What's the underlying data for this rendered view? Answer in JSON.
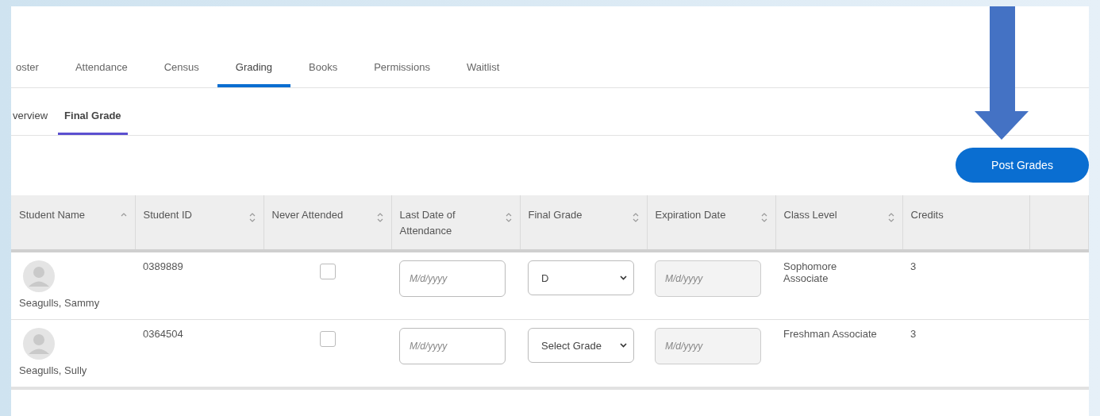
{
  "tabs": [
    {
      "label": "oster",
      "selected": false
    },
    {
      "label": "Attendance",
      "selected": false
    },
    {
      "label": "Census",
      "selected": false
    },
    {
      "label": "Grading",
      "selected": true
    },
    {
      "label": "Books",
      "selected": false
    },
    {
      "label": "Permissions",
      "selected": false
    },
    {
      "label": "Waitlist",
      "selected": false
    }
  ],
  "subtabs": [
    {
      "label": "verview",
      "selected": false
    },
    {
      "label": "Final Grade",
      "selected": true
    }
  ],
  "post_button": {
    "label": "Post Grades"
  },
  "table": {
    "columns": [
      {
        "label": "Student Name",
        "sort_up": true,
        "sort_down": false
      },
      {
        "label": "Student ID",
        "sort_up": true,
        "sort_down": true
      },
      {
        "label": "Never Attended",
        "sort_up": true,
        "sort_down": true
      },
      {
        "label": "Last Date of Attendance",
        "sort_up": true,
        "sort_down": true
      },
      {
        "label": "Final Grade",
        "sort_up": true,
        "sort_down": true
      },
      {
        "label": "Expiration Date",
        "sort_up": true,
        "sort_down": true
      },
      {
        "label": "Class Level",
        "sort_up": true,
        "sort_down": true
      },
      {
        "label": "Credits",
        "sort_up": false,
        "sort_down": false
      }
    ],
    "rows": [
      {
        "name": "Seagulls, Sammy",
        "student_id": "0389889",
        "never_attended": {
          "checked": false
        },
        "last_date": {
          "placeholder": "M/d/yyyy"
        },
        "final_grade": {
          "value": "D"
        },
        "expiration_date": {
          "placeholder": "M/d/yyyy",
          "disabled": true
        },
        "class_level": "Sophomore Associate",
        "credits": "3"
      },
      {
        "name": "Seagulls, Sully",
        "student_id": "0364504",
        "never_attended": {
          "checked": false
        },
        "last_date": {
          "placeholder": "M/d/yyyy"
        },
        "final_grade": {
          "value": "Select Grade"
        },
        "expiration_date": {
          "placeholder": "M/d/yyyy",
          "disabled": true
        },
        "class_level": "Freshman Associate",
        "credits": "3"
      }
    ]
  }
}
